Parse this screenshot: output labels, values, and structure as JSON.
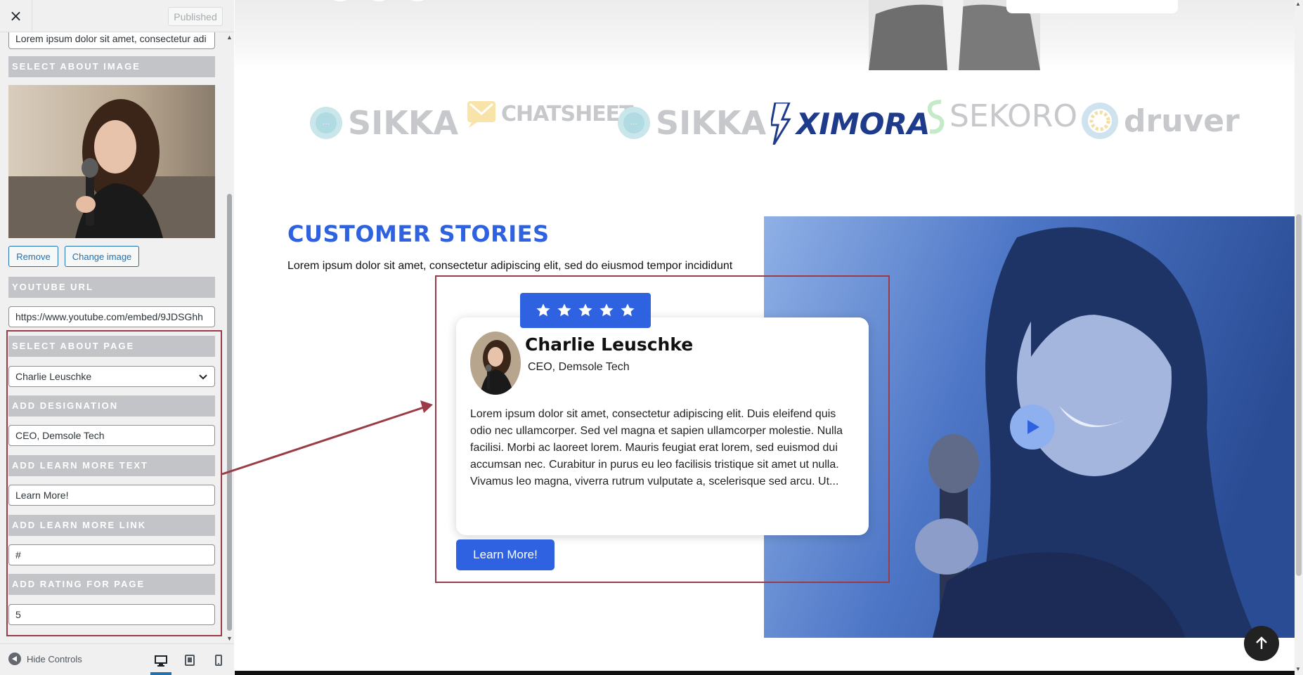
{
  "sidebar": {
    "close_label": "×",
    "publish_label": "Published",
    "top_input_value": "Lorem ipsum dolor sit amet, consectetur adi",
    "select_image_heading": "SELECT ABOUT IMAGE",
    "remove_label": "Remove",
    "change_image_label": "Change image",
    "youtube_heading": "YOUTUBE URL",
    "youtube_value": "https://www.youtube.com/embed/9JDSGhh",
    "about_page_heading": "SELECT ABOUT PAGE",
    "about_page_value": "Charlie Leuschke",
    "designation_heading": "ADD DESIGNATION",
    "designation_value": "CEO, Demsole Tech",
    "learn_text_heading": "ADD LEARN MORE TEXT",
    "learn_text_value": "Learn More!",
    "learn_link_heading": "ADD LEARN MORE LINK",
    "learn_link_value": "#",
    "rating_heading": "ADD RATING FOR PAGE",
    "rating_value": "5",
    "hide_controls_label": "Hide Controls"
  },
  "logos": [
    {
      "name": "SIKKA",
      "icon": "sikka-icon"
    },
    {
      "name": "CHATSHEET",
      "icon": "chatsheet-icon"
    },
    {
      "name": "SIKKA",
      "icon": "sikka-icon"
    },
    {
      "name": "XIMORA",
      "icon": "ximora-icon"
    },
    {
      "name": "SEKORO",
      "icon": "sekoro-icon"
    },
    {
      "name": "druver",
      "icon": "druver-icon"
    }
  ],
  "section": {
    "title": "CUSTOMER STORIES",
    "description": "Lorem ipsum dolor sit amet, consectetur adipiscing elit, sed do eiusmod tempor incididunt"
  },
  "story": {
    "rating": 5,
    "name": "Charlie Leuschke",
    "role": "CEO, Demsole Tech",
    "text": "Lorem ipsum dolor sit amet, consectetur adipiscing elit. Duis eleifend quis odio nec ullamcorper. Sed vel magna et sapien ullamcorper molestie. Nulla facilisi. Morbi ac laoreet lorem. Mauris feugiat erat lorem, sed euismod dui accumsan nec. Curabitur in purus eu leo facilisis tristique sit amet ut nulla. Vivamus leo magna, viverra rutrum vulputate a, scelerisque sed arcu. Ut...",
    "button_label": "Learn More!"
  },
  "colors": {
    "accent": "#2e62e0",
    "annotation": "#9b3b47",
    "control_heading_bg": "#c3c4c7",
    "wp_blue": "#2271b1"
  }
}
